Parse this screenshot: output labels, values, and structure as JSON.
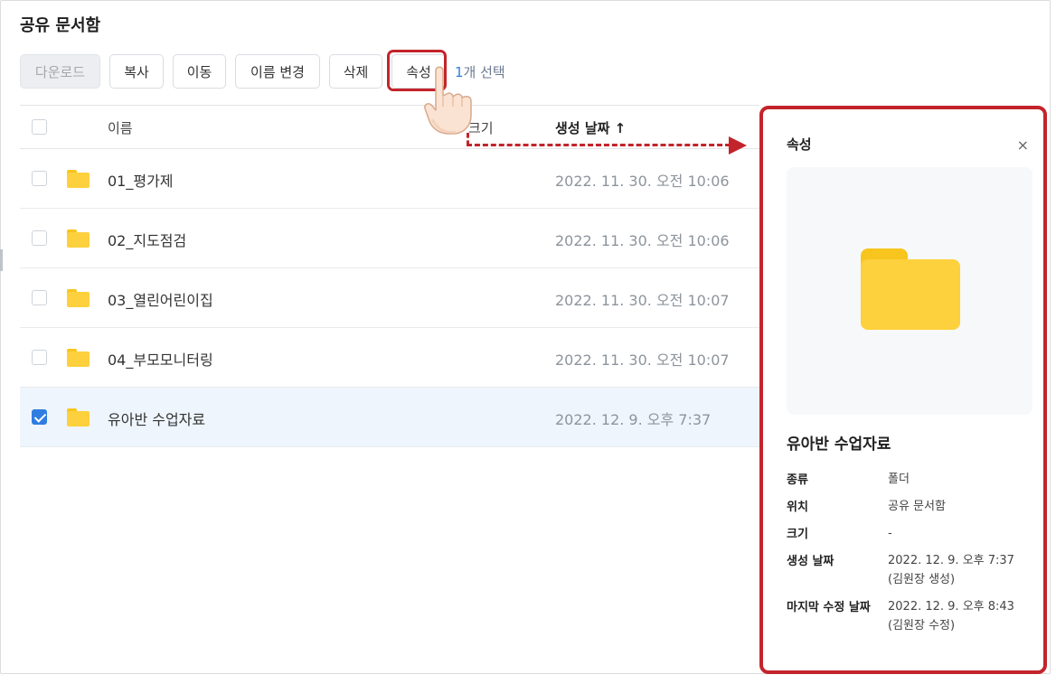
{
  "page": {
    "title": "공유 문서함"
  },
  "toolbar": {
    "buttons": [
      {
        "label": "다운로드"
      },
      {
        "label": "복사"
      },
      {
        "label": "이동"
      },
      {
        "label": "이름 변경"
      },
      {
        "label": "삭제"
      },
      {
        "label": "속성"
      }
    ],
    "selection_count": "1",
    "selection_suffix": "개 선택"
  },
  "table": {
    "columns": {
      "name": "이름",
      "size": "크기",
      "created": "생성 날짜 ↑"
    },
    "rows": [
      {
        "name": "01_평가제",
        "date": "2022. 11. 30. 오전 10:06"
      },
      {
        "name": "02_지도점검",
        "date": "2022. 11. 30. 오전 10:06"
      },
      {
        "name": "03_열린어린이집",
        "date": "2022. 11. 30. 오전 10:07"
      },
      {
        "name": "04_부모모니터링",
        "date": "2022. 11. 30. 오전 10:07"
      },
      {
        "name": "유아반 수업자료",
        "date": "2022. 12. 9. 오후 7:37",
        "selected": true
      }
    ]
  },
  "panel": {
    "title": "속성",
    "close": "×",
    "item_name": "유아반 수업자료",
    "props": [
      {
        "key": "종류",
        "value": "폴더"
      },
      {
        "key": "위치",
        "value": "공유 문서함"
      },
      {
        "key": "크기",
        "value": "-"
      },
      {
        "key": "생성 날짜",
        "value": "2022. 12. 9. 오후 7:37",
        "value2": "(김원장 생성)"
      },
      {
        "key": "마지막 수정 날짜",
        "value": "2022. 12. 9. 오후 8:43",
        "value2": "(김원장 수정)"
      }
    ]
  },
  "colors": {
    "accent": "#2f7de1",
    "highlight": "#c3242b",
    "folder": "#fdd03d"
  }
}
